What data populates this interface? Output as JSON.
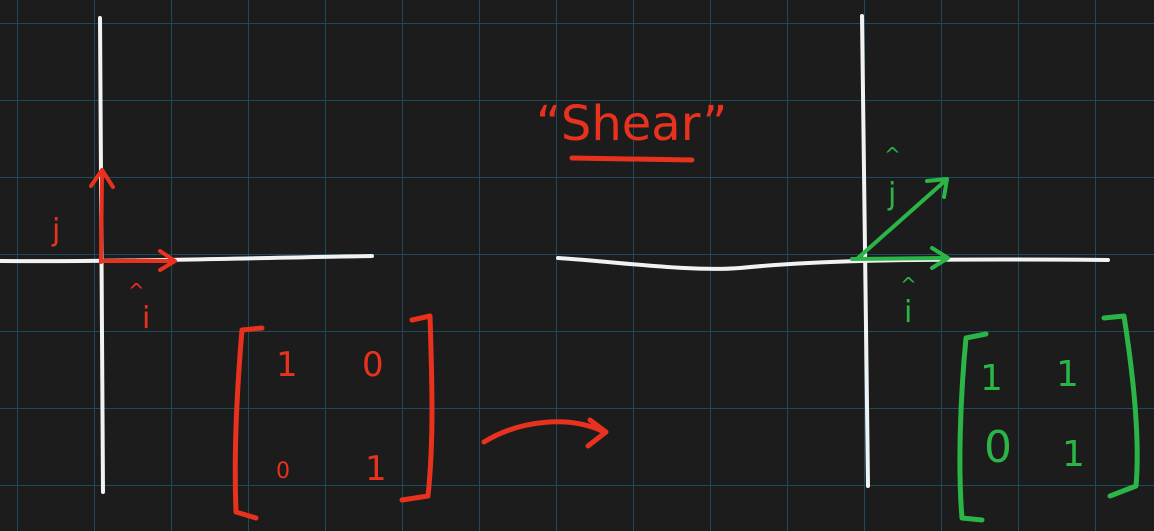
{
  "colors": {
    "background": "#1c1c1c",
    "grid": "#1f4a5c",
    "axes": "#f2f2f2",
    "original": "#e8321e",
    "transformed": "#2bb547"
  },
  "title": "“Shear”",
  "left": {
    "j_label": "j",
    "j_hat": "^",
    "i_label": "i",
    "i_hat": "^",
    "matrix": [
      [
        "1",
        "0"
      ],
      [
        "0",
        "1"
      ]
    ]
  },
  "right": {
    "j_label": "j",
    "j_hat": "^",
    "i_label": "i",
    "i_hat": "^",
    "matrix": [
      [
        "1",
        "1"
      ],
      [
        "0",
        "1"
      ]
    ]
  },
  "icons": {
    "transform_arrow": "curved-arrow-icon"
  }
}
